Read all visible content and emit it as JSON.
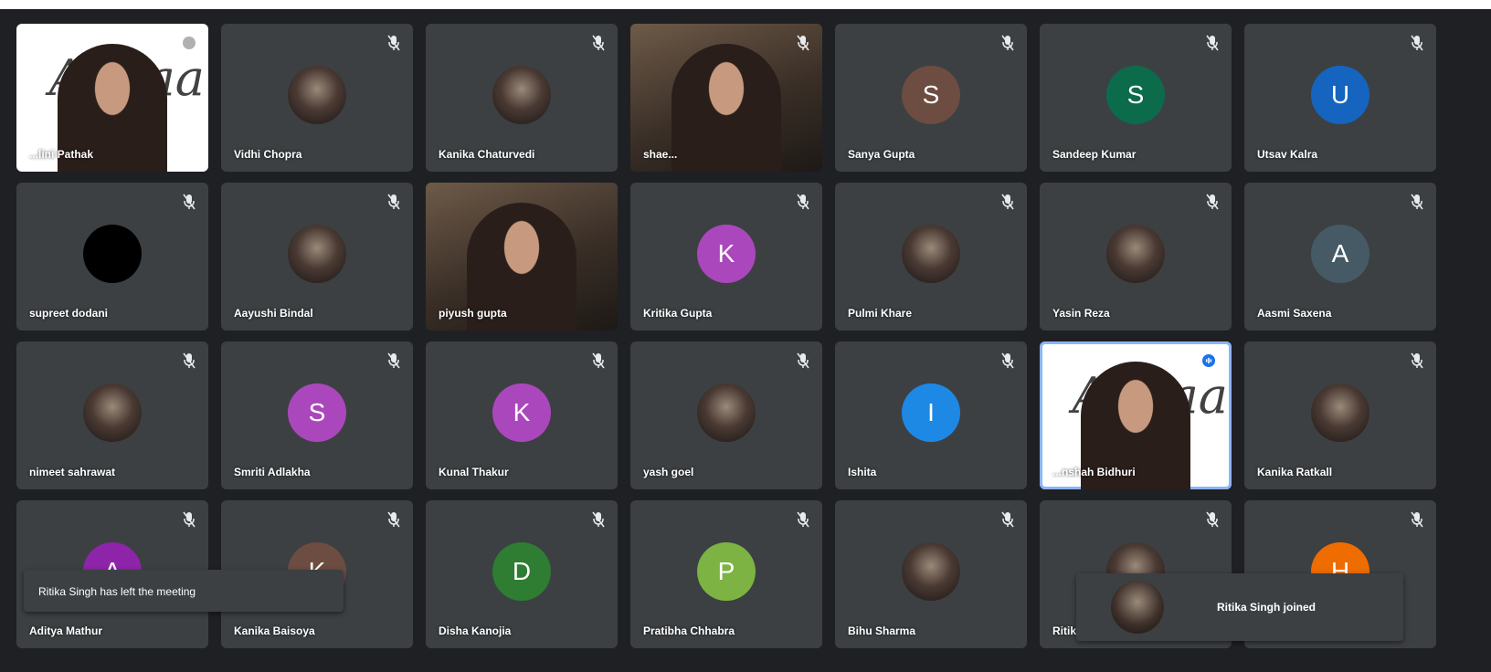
{
  "colors": {
    "background": "#1f2023",
    "tile": "#3c4043",
    "active_speaker_border": "#8ab4f8"
  },
  "tiles": [
    {
      "name": "...lini Pathak",
      "type": "poster",
      "avatar": "",
      "color": ""
    },
    {
      "name": "Vidhi Chopra",
      "type": "avatar",
      "avatar": "photo",
      "color": ""
    },
    {
      "name": "Kanika Chaturvedi",
      "type": "avatar",
      "avatar": "photo",
      "color": ""
    },
    {
      "name": "shae...",
      "type": "video",
      "avatar": "",
      "color": ""
    },
    {
      "name": "Sanya Gupta",
      "type": "avatar",
      "avatar": "S",
      "color": "#6d4c41"
    },
    {
      "name": "Sandeep Kumar",
      "type": "avatar",
      "avatar": "S",
      "color": "#0b6b4a"
    },
    {
      "name": "Utsav Kalra",
      "type": "avatar",
      "avatar": "U",
      "color": "#1565c0"
    },
    {
      "name": "supreet dodani",
      "type": "avatar",
      "avatar": "photo-dark",
      "color": "#000000"
    },
    {
      "name": "Aayushi Bindal",
      "type": "avatar",
      "avatar": "photo",
      "color": ""
    },
    {
      "name": "piyush gupta",
      "type": "video",
      "avatar": "",
      "color": ""
    },
    {
      "name": "Kritika Gupta",
      "type": "avatar",
      "avatar": "K",
      "color": "#ab47bc"
    },
    {
      "name": "Pulmi Khare",
      "type": "avatar",
      "avatar": "photo",
      "color": ""
    },
    {
      "name": "Yasin Reza",
      "type": "avatar",
      "avatar": "photo",
      "color": ""
    },
    {
      "name": "Aasmi Saxena",
      "type": "avatar",
      "avatar": "A",
      "color": "#455a64"
    },
    {
      "name": "nimeet sahrawat",
      "type": "avatar",
      "avatar": "photo",
      "color": ""
    },
    {
      "name": "Smriti Adlakha",
      "type": "avatar",
      "avatar": "S",
      "color": "#ab47bc"
    },
    {
      "name": "Kunal Thakur",
      "type": "avatar",
      "avatar": "K",
      "color": "#ab47bc"
    },
    {
      "name": "yash goel",
      "type": "avatar",
      "avatar": "photo",
      "color": ""
    },
    {
      "name": "Ishita",
      "type": "avatar",
      "avatar": "I",
      "color": "#1e88e5"
    },
    {
      "name": "...nshah Bidhuri",
      "type": "poster-speaking",
      "avatar": "",
      "color": ""
    },
    {
      "name": "Kanika Ratkall",
      "type": "avatar",
      "avatar": "photo",
      "color": ""
    },
    {
      "name": "Aditya Mathur",
      "type": "avatar",
      "avatar": "A",
      "color": "#8e24aa"
    },
    {
      "name": "Kanika Baisoya",
      "type": "avatar",
      "avatar": "K",
      "color": "#6d4c41"
    },
    {
      "name": "Disha Kanojia",
      "type": "avatar",
      "avatar": "D",
      "color": "#2e7d32"
    },
    {
      "name": "Pratibha Chhabra",
      "type": "avatar",
      "avatar": "P",
      "color": "#7cb342"
    },
    {
      "name": "Bihu Sharma",
      "type": "avatar",
      "avatar": "photo",
      "color": ""
    },
    {
      "name": "Ritika",
      "type": "avatar",
      "avatar": "photo",
      "color": ""
    },
    {
      "name": "",
      "type": "avatar",
      "avatar": "H",
      "color": "#ef6c00"
    }
  ],
  "poster_text": "Aahaa",
  "notifications": {
    "left": "Ritika Singh has left the meeting",
    "right": "Ritika Singh joined"
  },
  "icons": {
    "mic": "mic-off-icon",
    "speaking": "audio-level-icon"
  }
}
